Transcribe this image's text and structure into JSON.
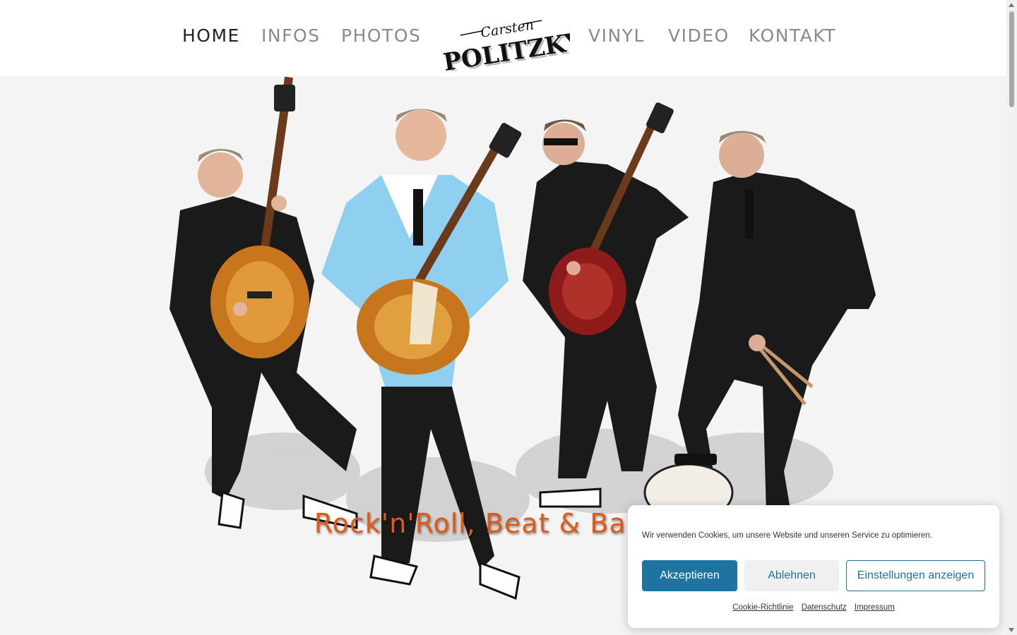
{
  "nav": {
    "items": [
      {
        "label": "HOME"
      },
      {
        "label": "INFOS"
      },
      {
        "label": "PHOTOS"
      },
      {
        "label": "VINYL"
      },
      {
        "label": "VIDEO"
      },
      {
        "label": "KONTAKT"
      }
    ],
    "logo": {
      "top_text": "Carsten",
      "main_text": "POLITZKY"
    }
  },
  "hero": {
    "tagline": "Rock'n'Roll, Beat & Ballads",
    "tagline_color": "#e05a15"
  },
  "cookie": {
    "message": "Wir verwenden Cookies, um unsere Website und unseren Service zu optimieren.",
    "accept_label": "Akzeptieren",
    "deny_label": "Ablehnen",
    "settings_label": "Einstellungen anzeigen",
    "links": [
      "Cookie-Richtlinie",
      "Datenschutz",
      "Impressum"
    ],
    "accent_color": "#1e73a0"
  }
}
